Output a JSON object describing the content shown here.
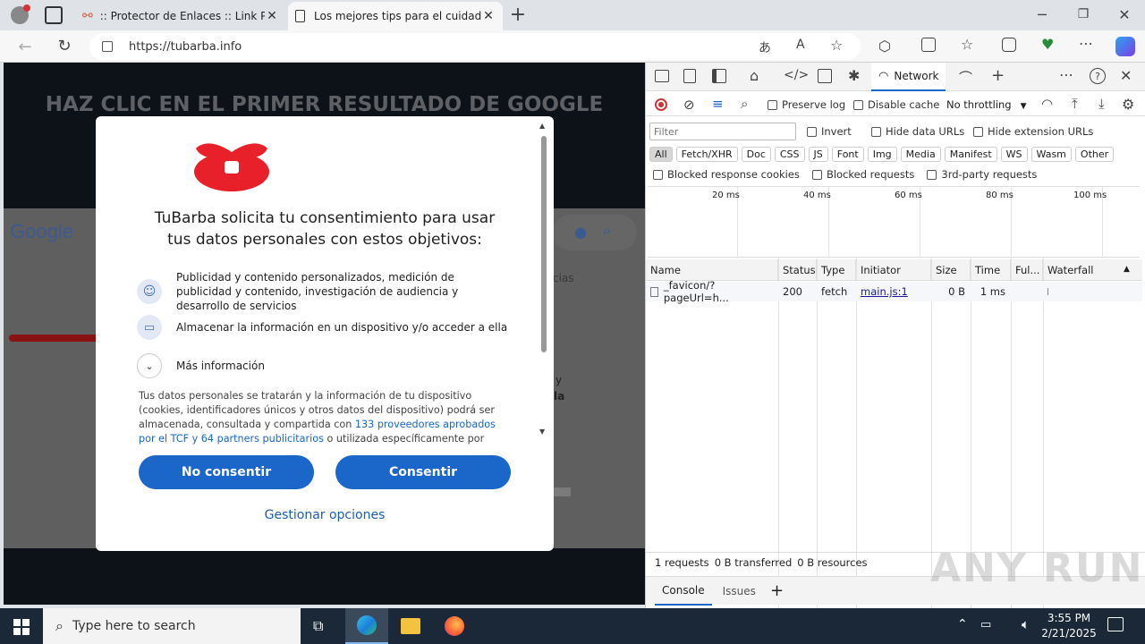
{
  "tabs": [
    {
      "label": ":: Protector de Enlaces :: Link Prot"
    },
    {
      "label": "Los mejores tips para el cuidado"
    }
  ],
  "address": {
    "url": "https://tubarba.info"
  },
  "page": {
    "banner": "HAZ CLIC EN EL PRIMER RESULTADO DE GOOGLE",
    "google_logo": "Google",
    "bg_fragment_1": "cias",
    "bg_fragment_2": "y",
    "bg_fragment_3": "la"
  },
  "modal": {
    "title": "TuBarba solicita tu consentimiento para usar tus datos personales con estos objetivos:",
    "purposes": [
      {
        "text": "Publicidad y contenido personalizados, medición de publicidad y contenido, investigación de audiencia y desarrollo de servicios",
        "icon": "person-icon"
      },
      {
        "text": "Almacenar la información en un dispositivo y/o acceder a ella",
        "icon": "devices-icon"
      }
    ],
    "more_info": "Más información",
    "body_text_1": "Tus datos personales se tratarán y la información de tu dispositivo (cookies, identificadores únicos y otros datos del dispositivo) podrá ser almacenada, consultada y compartida con",
    "body_link": "133 proveedores aprobados por el TCF y 64 partners publicitarios",
    "body_text_2": "o utilizada específicamente por este",
    "reject_label": "No consentir",
    "accept_label": "Consentir",
    "manage_label": "Gestionar opciones",
    "accent_color": "#1a66c9"
  },
  "devtools": {
    "active_tab": "Network",
    "preserve_log": "Preserve log",
    "disable_cache": "Disable cache",
    "throttling": "No throttling",
    "filter_placeholder": "Filter",
    "invert": "Invert",
    "hide_data_urls": "Hide data URLs",
    "hide_extension_urls": "Hide extension URLs",
    "type_filters": [
      "All",
      "Fetch/XHR",
      "Doc",
      "CSS",
      "JS",
      "Font",
      "Img",
      "Media",
      "Manifest",
      "WS",
      "Wasm",
      "Other"
    ],
    "blocked_cookies": "Blocked response cookies",
    "blocked_requests": "Blocked requests",
    "third_party": "3rd-party requests",
    "timeline_ticks": [
      "20 ms",
      "40 ms",
      "60 ms",
      "80 ms",
      "100 ms"
    ],
    "columns": [
      "Name",
      "Status",
      "Type",
      "Initiator",
      "Size",
      "Time",
      "Ful...",
      "Waterfall"
    ],
    "rows": [
      {
        "name": "_favicon/?pageUrl=h...",
        "status": "200",
        "type": "fetch",
        "initiator": "main.js:1",
        "size": "0 B",
        "time": "1 ms"
      }
    ],
    "summary": {
      "requests": "1 requests",
      "transferred": "0 B transferred",
      "resources": "0 B resources"
    },
    "drawer_tabs": [
      "Console",
      "Issues"
    ]
  },
  "watermark": "ANY RUN",
  "taskbar": {
    "search_placeholder": "Type here to search",
    "time": "3:55 PM",
    "date": "2/21/2025"
  }
}
